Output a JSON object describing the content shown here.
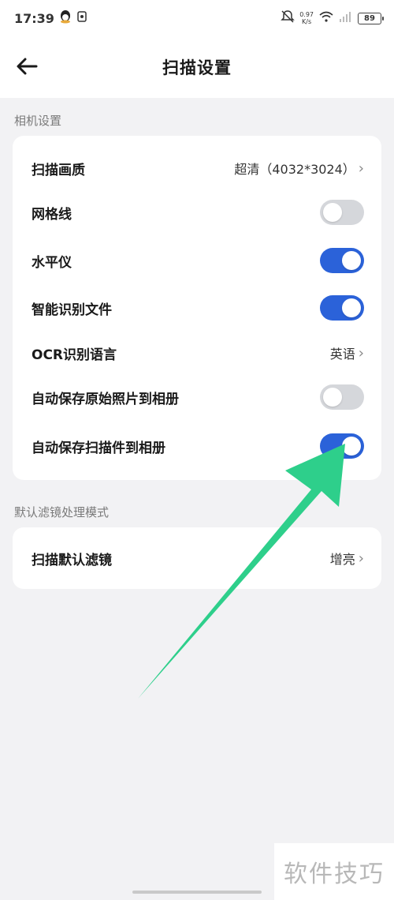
{
  "status_bar": {
    "time": "17:39",
    "net_speed_value": "0.97",
    "net_speed_unit": "K/s",
    "battery": "89"
  },
  "header": {
    "title": "扫描设置"
  },
  "sections": [
    {
      "label": "相机设置",
      "rows": [
        {
          "label": "扫描画质",
          "value": "超清（4032*3024）"
        },
        {
          "label": "网格线",
          "toggle": false
        },
        {
          "label": "水平仪",
          "toggle": true
        },
        {
          "label": "智能识别文件",
          "toggle": true
        },
        {
          "label": "OCR识别语言",
          "value": "英语"
        },
        {
          "label": "自动保存原始照片到相册",
          "toggle": false
        },
        {
          "label": "自动保存扫描件到相册",
          "toggle": true
        }
      ]
    },
    {
      "label": "默认滤镜处理模式",
      "rows": [
        {
          "label": "扫描默认滤镜",
          "value": "增亮"
        }
      ]
    }
  ],
  "overlay": {
    "arrow_color": "#2ecf8b"
  },
  "watermark": "软件技巧",
  "colors": {
    "toggle_on": "#2b62d9",
    "toggle_off": "#d5d7db"
  }
}
